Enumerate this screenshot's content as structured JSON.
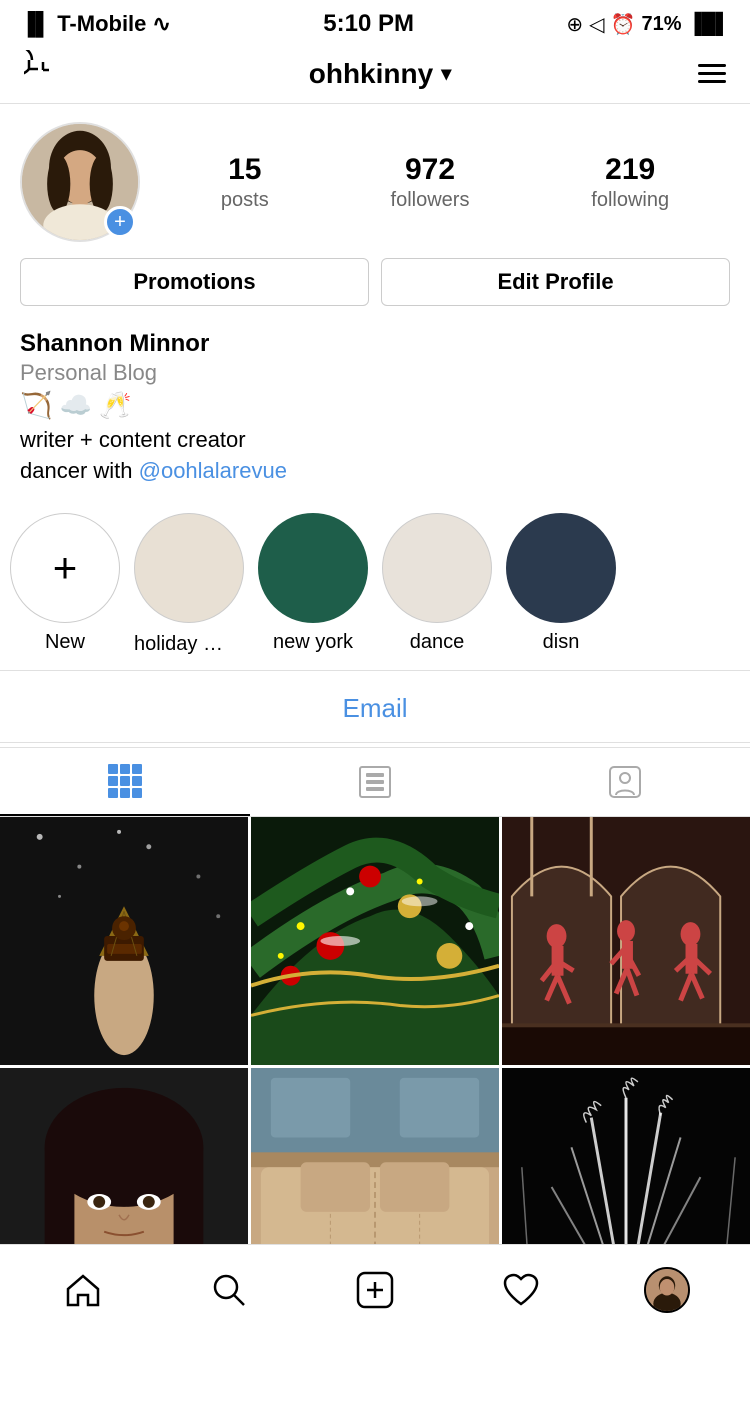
{
  "statusBar": {
    "carrier": "T-Mobile",
    "time": "5:10 PM",
    "battery": "71%"
  },
  "nav": {
    "username": "ohhkinny",
    "chevron": "▾"
  },
  "profile": {
    "name": "Shannon Minnor",
    "category": "Personal Blog",
    "emojis": "🏹 ☁️ 🥂",
    "bio_line1": "writer + content creator",
    "bio_line2": "dancer with ",
    "bio_link": "@oohlalarevue",
    "stats": {
      "posts": "15",
      "posts_label": "posts",
      "followers": "972",
      "followers_label": "followers",
      "following": "219",
      "following_label": "following"
    },
    "buttons": {
      "promotions": "Promotions",
      "edit_profile": "Edit Profile"
    }
  },
  "stories": [
    {
      "label": "New",
      "type": "new"
    },
    {
      "label": "holiday 🥂 ...",
      "type": "beige"
    },
    {
      "label": "new york",
      "type": "dark-green"
    },
    {
      "label": "dance",
      "type": "beige2"
    },
    {
      "label": "disn",
      "type": "dark-navy"
    }
  ],
  "email": {
    "label": "Email"
  },
  "tabs": {
    "grid": "grid",
    "feed": "feed",
    "tagged": "tagged"
  },
  "bottomNav": {
    "home": "home",
    "search": "search",
    "add": "add",
    "activity": "activity",
    "profile": "profile"
  }
}
